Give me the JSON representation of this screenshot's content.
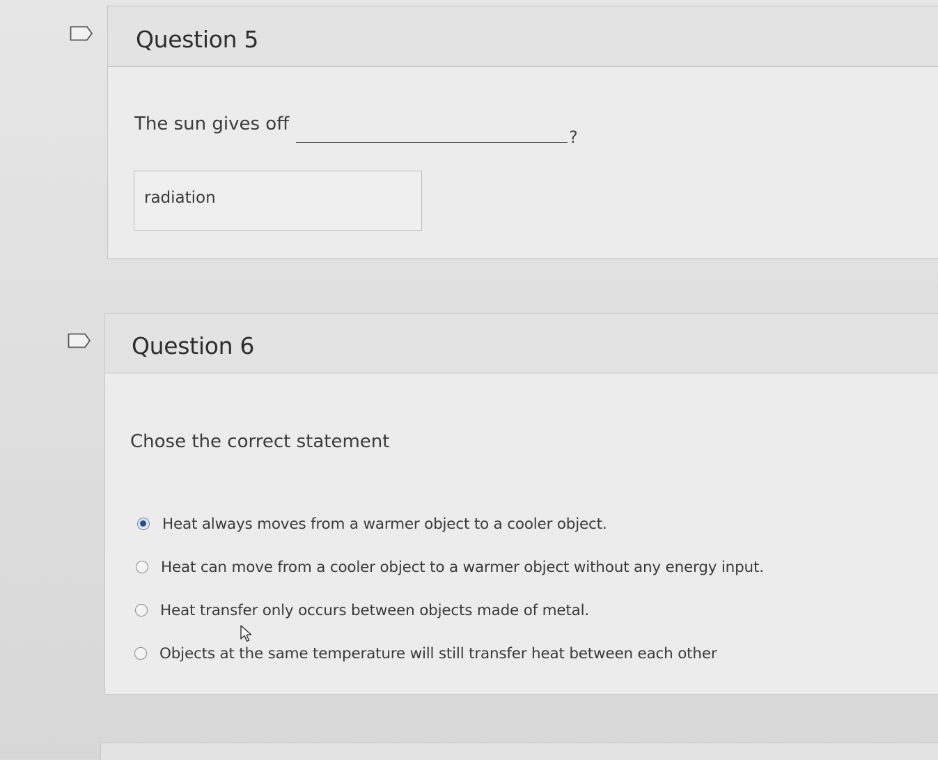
{
  "questions": [
    {
      "title": "Question 5",
      "prompt": "The sun gives off",
      "prompt_suffix": "?",
      "answer_value": "radiation",
      "flag_icon": "flag-icon"
    },
    {
      "title": "Question 6",
      "prompt": "Chose the correct statement",
      "flag_icon": "flag-icon",
      "selected_index": 0,
      "options": [
        "Heat always moves from a warmer object to a cooler object.",
        "Heat can move from a cooler object to a warmer object without any energy input.",
        "Heat transfer only occurs between objects made of metal.",
        "Objects at the same temperature will still transfer heat between each other"
      ]
    }
  ],
  "colors": {
    "accent_radio": "#2b4f8e",
    "background": "#e6e6e6",
    "border": "#c6c6c6"
  },
  "icons": [
    "flag-icon",
    "radio-selected-icon",
    "radio-empty-icon",
    "mouse-pointer-icon"
  ]
}
